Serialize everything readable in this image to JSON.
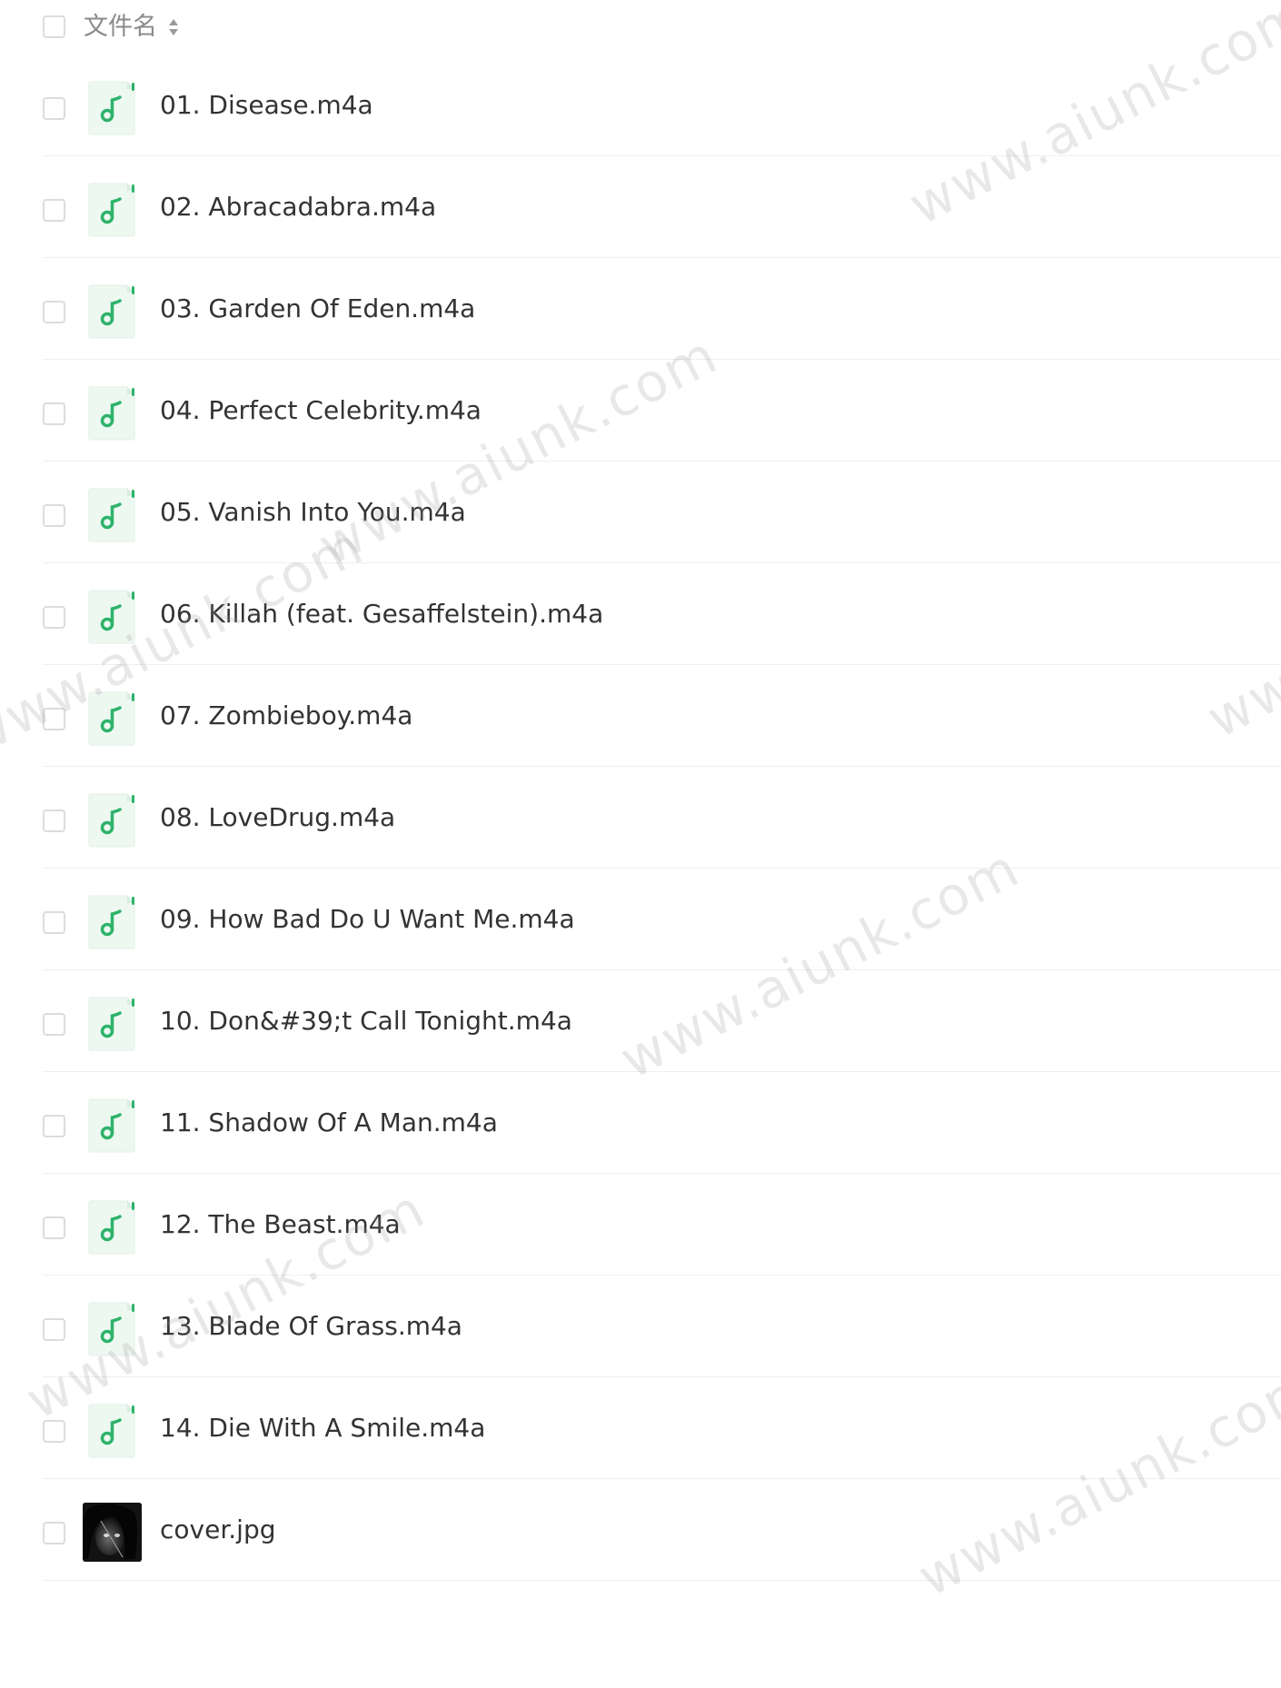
{
  "header": {
    "column_label": "文件名"
  },
  "icons": {
    "audio": "music-note-file-icon",
    "image": "image-thumbnail",
    "sort": "sort-arrows-icon",
    "checkbox": "checkbox"
  },
  "colors": {
    "accent": "#2db36a",
    "icon_bg": "#edf8f1",
    "text": "#333333",
    "header_text": "#8a8a8a",
    "divider": "#efefef",
    "checkbox_border": "#dcdcdc"
  },
  "files": [
    {
      "name": "01. Disease.m4a",
      "type": "audio"
    },
    {
      "name": "02. Abracadabra.m4a",
      "type": "audio"
    },
    {
      "name": "03. Garden Of Eden.m4a",
      "type": "audio"
    },
    {
      "name": "04. Perfect Celebrity.m4a",
      "type": "audio"
    },
    {
      "name": "05. Vanish Into You.m4a",
      "type": "audio"
    },
    {
      "name": "06. Killah (feat. Gesaffelstein).m4a",
      "type": "audio"
    },
    {
      "name": "07. Zombieboy.m4a",
      "type": "audio"
    },
    {
      "name": "08. LoveDrug.m4a",
      "type": "audio"
    },
    {
      "name": "09. How Bad Do U Want Me.m4a",
      "type": "audio"
    },
    {
      "name": "10. Don&#39;t Call Tonight.m4a",
      "type": "audio"
    },
    {
      "name": "11. Shadow Of A Man.m4a",
      "type": "audio"
    },
    {
      "name": "12. The Beast.m4a",
      "type": "audio"
    },
    {
      "name": "13. Blade Of Grass.m4a",
      "type": "audio"
    },
    {
      "name": "14. Die With A Smile.m4a",
      "type": "audio"
    },
    {
      "name": "cover.jpg",
      "type": "image"
    }
  ],
  "watermark": {
    "text": "www.aiunk.com"
  }
}
